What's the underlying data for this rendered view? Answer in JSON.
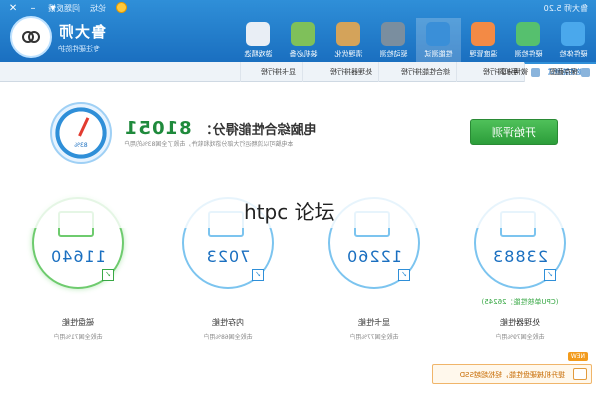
{
  "window": {
    "version": "鲁大师 5.20",
    "title_links": [
      "问题反馈",
      "论坛"
    ]
  },
  "logo": {
    "name": "鲁大师",
    "subtitle": "专注硬件防护"
  },
  "nav": [
    {
      "label": "硬件体检",
      "color": "#4aa8ec"
    },
    {
      "label": "硬件检测",
      "color": "#56c06e"
    },
    {
      "label": "温度管理",
      "color": "#f38a45"
    },
    {
      "label": "性能测试",
      "color": "#3a8fd8",
      "active": true
    },
    {
      "label": "驱动检测",
      "color": "#7a8e9f"
    },
    {
      "label": "清理优化",
      "color": "#d4a35a"
    },
    {
      "label": "装机必备",
      "color": "#7fc05a"
    },
    {
      "label": "游戏精选",
      "color": "#e9eef5"
    }
  ],
  "tabs": [
    {
      "label": "电脑性能测试",
      "active": true
    },
    {
      "label": "手机排行榜"
    },
    {
      "label": "综合性能排行榜"
    },
    {
      "label": "处理器排行榜"
    },
    {
      "label": "显卡排行榜"
    }
  ],
  "tab_links": [
    "微博分享",
    "保存截图"
  ],
  "score": {
    "title": "电脑综合性能得分：",
    "value": "81051",
    "desc": "本电脑可以流畅运行大部分游戏和软件，击败了全国83%的用户",
    "gauge_label": "83%"
  },
  "start_button": "开始评测",
  "cards": [
    {
      "name": "处理器性能",
      "value": "23883",
      "rank": "击败全国79%用户",
      "extra": "(CPU单核性能：26245)",
      "green": false
    },
    {
      "name": "显卡性能",
      "value": "12260",
      "rank": "击败全国77%用户",
      "extra": "",
      "green": false
    },
    {
      "name": "内存性能",
      "value": "7023",
      "rank": "击败全国68%用户",
      "extra": "",
      "green": false
    },
    {
      "name": "磁盘性能",
      "value": "11640",
      "rank": "击败全国71%用户",
      "extra": "",
      "green": true
    }
  ],
  "promo": {
    "badge": "NEW",
    "text": "提升机械硬盘性能，轻松超越SSD"
  },
  "watermark": "htpc 论坛"
}
